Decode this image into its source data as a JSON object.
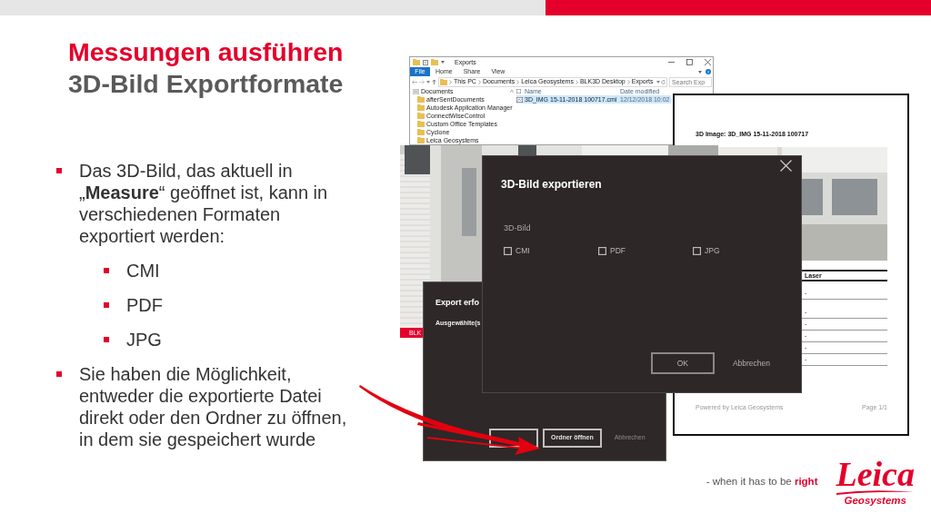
{
  "slide": {
    "title": "Messungen ausführen",
    "subtitle": "3D-Bild Exportformate"
  },
  "bullets": [
    {
      "text": "Das 3D-Bild, das aktuell in „**Measure**“ geöffnet ist, kann in verschiedenen Formaten exportiert werden:",
      "children": [
        {
          "text": "CMI"
        },
        {
          "text": "PDF"
        },
        {
          "text": "JPG"
        }
      ]
    },
    {
      "text": "Sie haben die Möglichkeit, entweder die exportierte Datei direkt oder den Ordner zu öffnen, in dem sie gespeichert wurde"
    }
  ],
  "explorer": {
    "title": "Exports",
    "ribbon_tabs": [
      {
        "label": "File",
        "selected": true
      },
      {
        "label": "Home",
        "selected": false
      },
      {
        "label": "Share",
        "selected": false
      },
      {
        "label": "View",
        "selected": false
      }
    ],
    "breadcrumb": [
      "This PC",
      "Documents",
      "Leica Geosystems",
      "BLK3D Desktop",
      "Exports"
    ],
    "search": {
      "placeholder": "Search Exp"
    },
    "sidebar": {
      "items": [
        {
          "label": "Documents",
          "children": [
            {
              "label": "afterSentDocuments"
            },
            {
              "label": "Autodesk Application Manager"
            },
            {
              "label": "ConnectWiseControl"
            },
            {
              "label": "Custom Office Templates"
            },
            {
              "label": "Cyclone"
            },
            {
              "label": "Leica Geosystems"
            }
          ]
        }
      ]
    },
    "columns": [
      "Name",
      "Date modified"
    ],
    "files": [
      {
        "name": "3D_IMG 15-11-2018 100717.cmi",
        "date_modified": "12/12/2018 10:02",
        "selected": true
      }
    ]
  },
  "report": {
    "title": "3D Image: 3D_IMG 15-11-2018 100717",
    "table": {
      "columns": [
        "Laser"
      ],
      "rows": [
        [
          "-"
        ],
        [
          "-"
        ],
        [
          "-"
        ],
        [
          "-"
        ],
        [
          "-"
        ],
        [
          "-"
        ]
      ]
    },
    "footer": {
      "left": "Powered by Leica Geosystems",
      "right": "Page 1/1"
    }
  },
  "viewer": {
    "status_bar": "BLK"
  },
  "success_dialog": {
    "title": "Export erfo",
    "message": "Ausgewählte(s",
    "buttons": [
      {
        "kind": "outlined"
      },
      {
        "kind": "outlined",
        "label": "Ordner öffnen"
      },
      {
        "kind": "text",
        "label": "Abbrechen"
      }
    ]
  },
  "export_dialog": {
    "title": "3D-Bild exportieren",
    "section_label": "3D-Bild",
    "options": [
      {
        "label": "CMI",
        "checked": false
      },
      {
        "label": "PDF",
        "checked": false
      },
      {
        "label": "JPG",
        "checked": false
      }
    ],
    "buttons": [
      {
        "kind": "outlined",
        "label": "OK"
      },
      {
        "kind": "text",
        "label": "Abbrechen"
      }
    ]
  },
  "footer": {
    "tagline": "- when it has to be **right**",
    "logo": "Leica",
    "logo_subtitle": "Geosystems"
  }
}
